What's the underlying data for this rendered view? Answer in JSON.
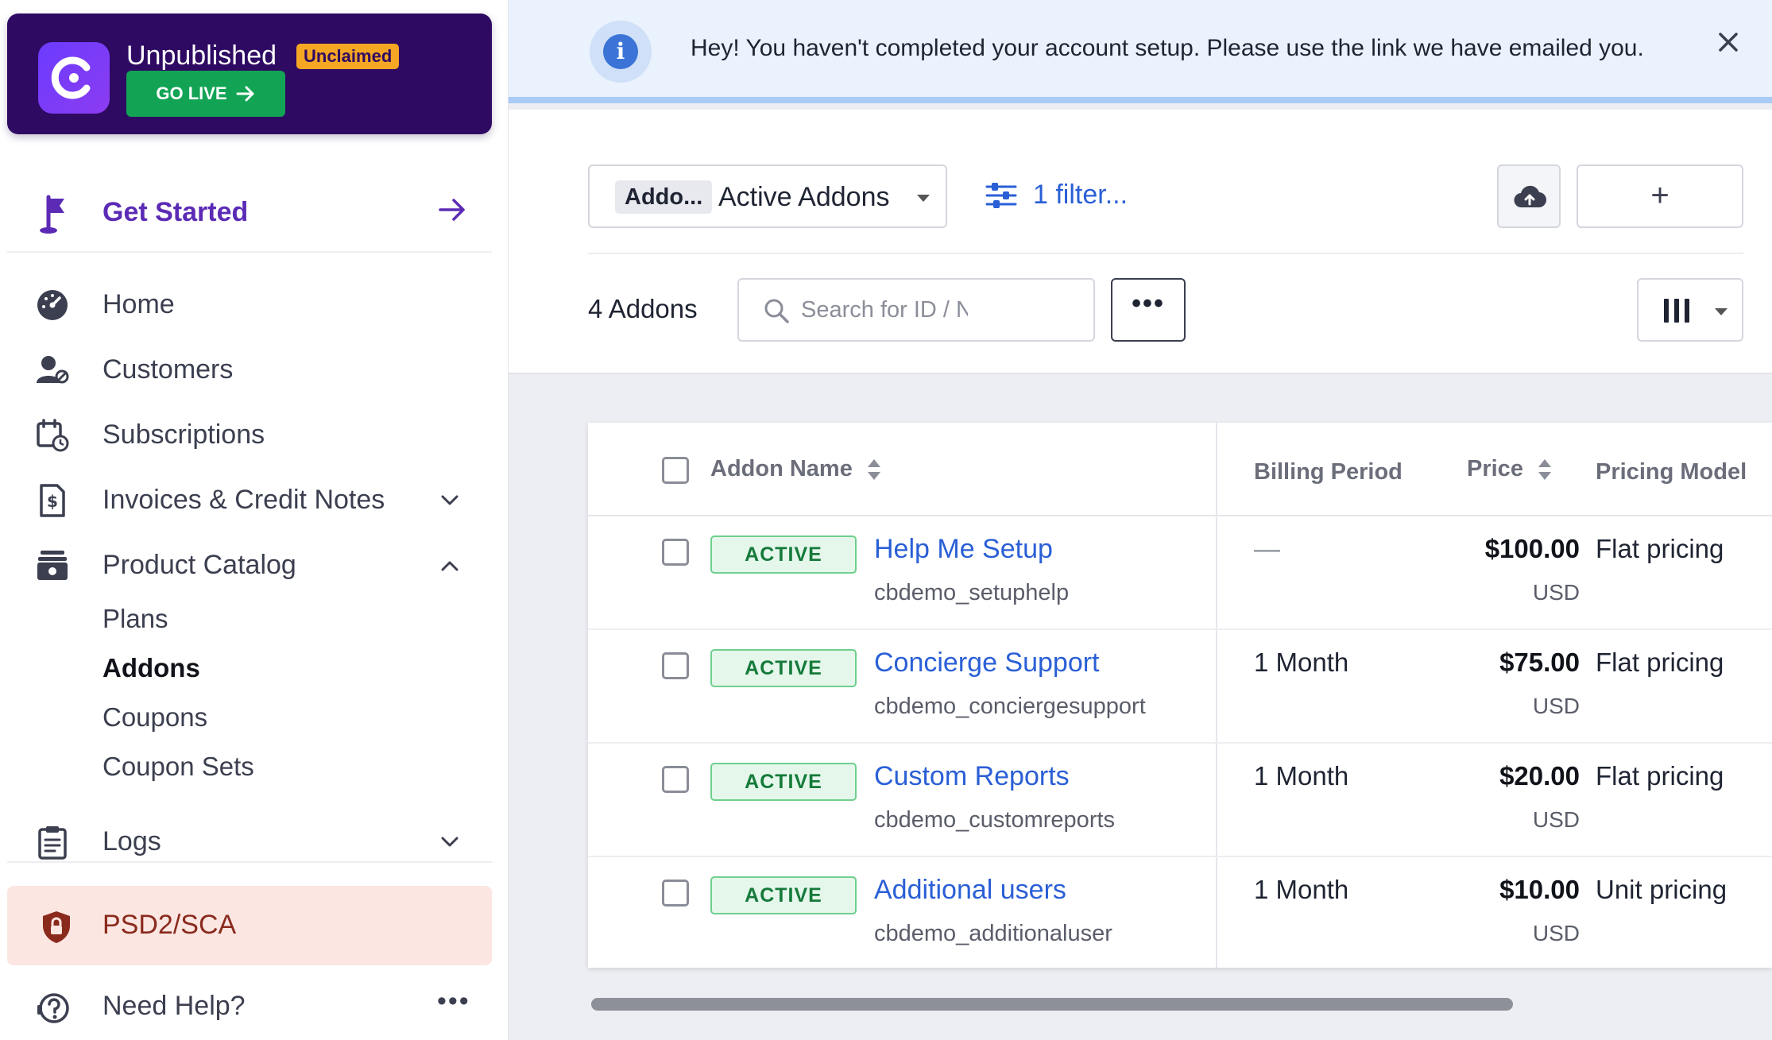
{
  "brand": {
    "title": "Unpublished",
    "badge": "Unclaimed",
    "go_live": "GO LIVE"
  },
  "sidebar": {
    "get_started": "Get Started",
    "items": [
      {
        "label": "Home",
        "icon": "dashboard-gauge-icon"
      },
      {
        "label": "Customers",
        "icon": "customers-icon"
      },
      {
        "label": "Subscriptions",
        "icon": "calendar-clock-icon"
      },
      {
        "label": "Invoices & Credit Notes",
        "icon": "invoice-dollar-icon",
        "expandable": true,
        "expanded": false
      },
      {
        "label": "Product Catalog",
        "icon": "catalog-box-icon",
        "expandable": true,
        "expanded": true
      },
      {
        "label": "Logs",
        "icon": "clipboard-icon",
        "expandable": true,
        "expanded": false
      }
    ],
    "sub_items": [
      "Plans",
      "Addons",
      "Coupons",
      "Coupon Sets"
    ],
    "active_sub_item": "Addons",
    "psd": "PSD2/SCA",
    "help": "Need Help?",
    "more": "•••"
  },
  "banner": {
    "message": "Hey! You haven't completed your account setup. Please use the link we have emailed you."
  },
  "toolbar": {
    "view_tag": "Addo...",
    "view_value": "Active Addons",
    "filter": "1 filter...",
    "add": "+",
    "count": "4 Addons",
    "search_placeholder": "Search for ID / Name",
    "more": "•••"
  },
  "table": {
    "headers": {
      "name": "Addon Name",
      "period": "Billing Period",
      "price": "Price",
      "model": "Pricing Model"
    },
    "rows": [
      {
        "status": "ACTIVE",
        "name": "Help Me Setup",
        "id": "cbdemo_setuphelp",
        "period": "—",
        "price": "$100.00",
        "currency": "USD",
        "model": "Flat pricing"
      },
      {
        "status": "ACTIVE",
        "name": "Concierge Support",
        "id": "cbdemo_conciergesupport",
        "period": "1 Month",
        "price": "$75.00",
        "currency": "USD",
        "model": "Flat pricing"
      },
      {
        "status": "ACTIVE",
        "name": "Custom Reports",
        "id": "cbdemo_customreports",
        "period": "1 Month",
        "price": "$20.00",
        "currency": "USD",
        "model": "Flat pricing"
      },
      {
        "status": "ACTIVE",
        "name": "Additional users",
        "id": "cbdemo_additionaluser",
        "period": "1 Month",
        "price": "$10.00",
        "currency": "USD",
        "model": "Unit pricing"
      }
    ]
  },
  "colors": {
    "brand_bg": "#2e0a63",
    "go_live": "#12a454",
    "link": "#2a5fd6",
    "active_badge": "#e4f7ea",
    "psd_bg": "#fbe6e2"
  }
}
